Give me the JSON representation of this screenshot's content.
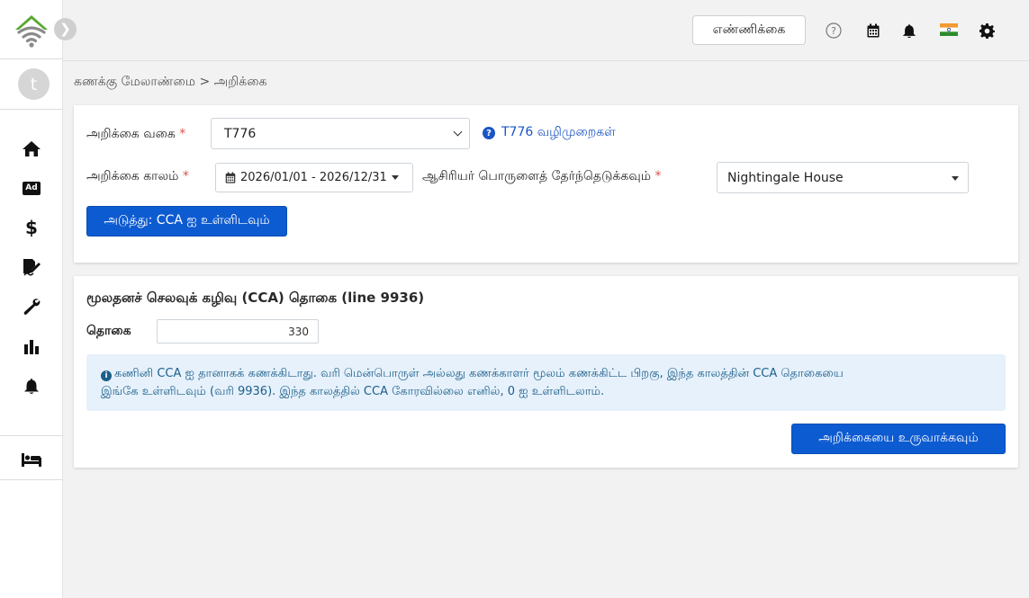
{
  "topbar": {
    "count_button": "எண்ணிக்கை",
    "help_icon": "question-circle-icon",
    "calendar_icon": "calendar-icon",
    "notification_icon": "bell-icon",
    "flag_icon": "india-flag-icon",
    "settings_icon": "gear-icon"
  },
  "sidebar": {
    "avatar_letter": "t",
    "ad_label": "Ad",
    "items": [
      {
        "icon": "home-icon"
      },
      {
        "icon": "ad-icon"
      },
      {
        "icon": "dollar-icon"
      },
      {
        "icon": "signature-icon"
      },
      {
        "icon": "wrench-icon"
      },
      {
        "icon": "bar-chart-icon"
      },
      {
        "icon": "bell-icon"
      },
      {
        "icon": "bed-icon"
      }
    ]
  },
  "breadcrumb": "கணக்கு மேலாண்மை > அறிக்கை",
  "report_form": {
    "type_label": "அறிக்கை வகை",
    "type_value": "T776",
    "guide_link": "T776 வழிமுறைகள்",
    "period_label": "அறிக்கை காலம்",
    "period_value": "2026/01/01 - 2026/12/31",
    "property_label": "ஆசிரியர் பொருளைத் தேர்ந்தெடுக்கவும்",
    "property_value": "Nightingale House",
    "next_button": "அடுத்து: CCA ஐ உள்ளிடவும்",
    "required_mark": "*"
  },
  "cca_section": {
    "title": "மூலதனச் செலவுக் கழிவு (CCA) தொகை  (line 9936)",
    "amount_label": "தொகை",
    "amount_value": "330",
    "info_line1": "கணினி CCA ஐ தானாகக் கணக்கிடாது. வரி மென்பொருள் அல்லது கணக்காளர் மூலம் கணக்கிட்ட பிறகு, இந்த காலத்தின் CCA தொகையை",
    "info_line2": "இங்கே உள்ளிடவும் (வரி 9936). இந்த காலத்தில் CCA கோரவில்லை எனில், 0 ஐ உள்ளிடலாம்.",
    "generate_button": "அறிக்கையை உருவாக்கவும்"
  },
  "colors": {
    "primary": "#0d5bd1",
    "link": "#1a56c4",
    "info_bg": "#e6f1fb",
    "info_text": "#1c5f8a",
    "logo_green": "#5aa832"
  }
}
